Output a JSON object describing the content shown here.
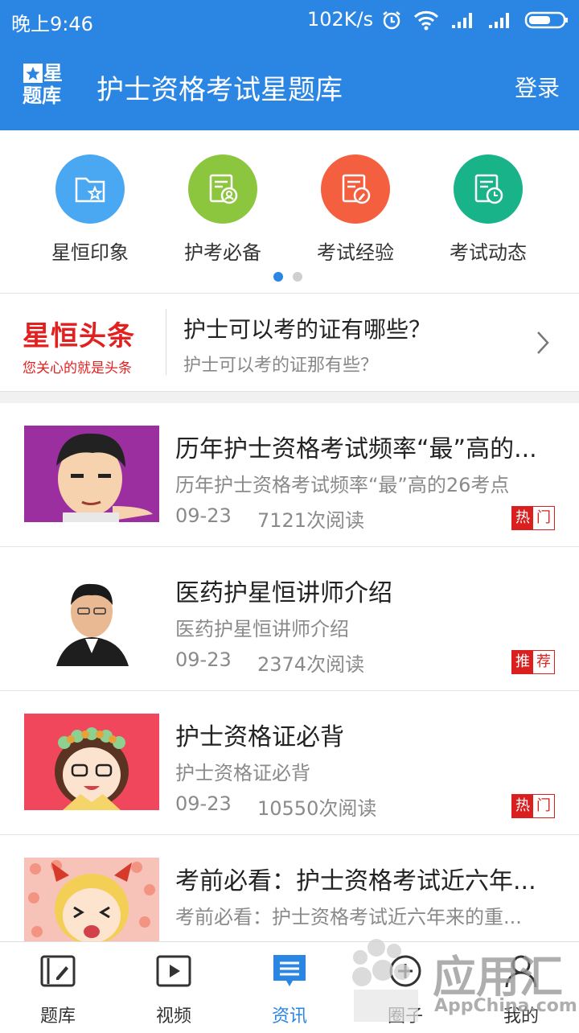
{
  "status_bar": {
    "time": "晚上9:46",
    "net_speed": "102K/s",
    "icons": [
      "alarm-icon",
      "wifi-icon",
      "signal-icon",
      "signal-icon",
      "battery-icon"
    ]
  },
  "app_bar": {
    "logo_line1": "星",
    "logo_line2": "题库",
    "title": "护士资格考试星题库",
    "login": "登录"
  },
  "categories": [
    {
      "label": "星恒印象",
      "color": "#4aa8f2",
      "icon": "folder-star-icon"
    },
    {
      "label": "护考必备",
      "color": "#8cc63e",
      "icon": "document-user-icon"
    },
    {
      "label": "考试经验",
      "color": "#f4603f",
      "icon": "document-pen-icon"
    },
    {
      "label": "考试动态",
      "color": "#19b38a",
      "icon": "document-clock-icon"
    }
  ],
  "headline": {
    "brand": "星恒头条",
    "brand_slogan": "您关心的就是头条",
    "title": "护士可以考的证有哪些？",
    "subtitle": "护士可以考的证那有些？"
  },
  "news": [
    {
      "title": "历年护士资格考试频率“最”高的...",
      "subtitle": "历年护士资格考试频率“最”高的26考点",
      "date": "09-23",
      "reads": "7121次阅读",
      "tag1": "热",
      "tag2": "门"
    },
    {
      "title": "医药护星恒讲师介绍",
      "subtitle": "医药护星恒讲师介绍",
      "date": "09-23",
      "reads": "2374次阅读",
      "tag1": "推",
      "tag2": "荐"
    },
    {
      "title": "护士资格证必背",
      "subtitle": "护士资格证必背",
      "date": "09-23",
      "reads": "10550次阅读",
      "tag1": "热",
      "tag2": "门"
    },
    {
      "title": "考前必看：护士资格考试近六年...",
      "subtitle": "考前必看：护士资格考试近六年来的重...",
      "date": "",
      "reads": "",
      "tag1": "",
      "tag2": ""
    }
  ],
  "tabs": [
    {
      "label": "题库",
      "icon": "book-pen-icon"
    },
    {
      "label": "视频",
      "icon": "video-play-icon"
    },
    {
      "label": "资讯",
      "icon": "news-chat-icon"
    },
    {
      "label": "圈子",
      "icon": "circle-plus-icon"
    },
    {
      "label": "我的",
      "icon": "user-icon"
    }
  ],
  "watermark": {
    "text": "应用汇",
    "url_text": "AppChina.com"
  },
  "colors": {
    "primary": "#2b86e3",
    "hot_red": "#d9201e"
  }
}
